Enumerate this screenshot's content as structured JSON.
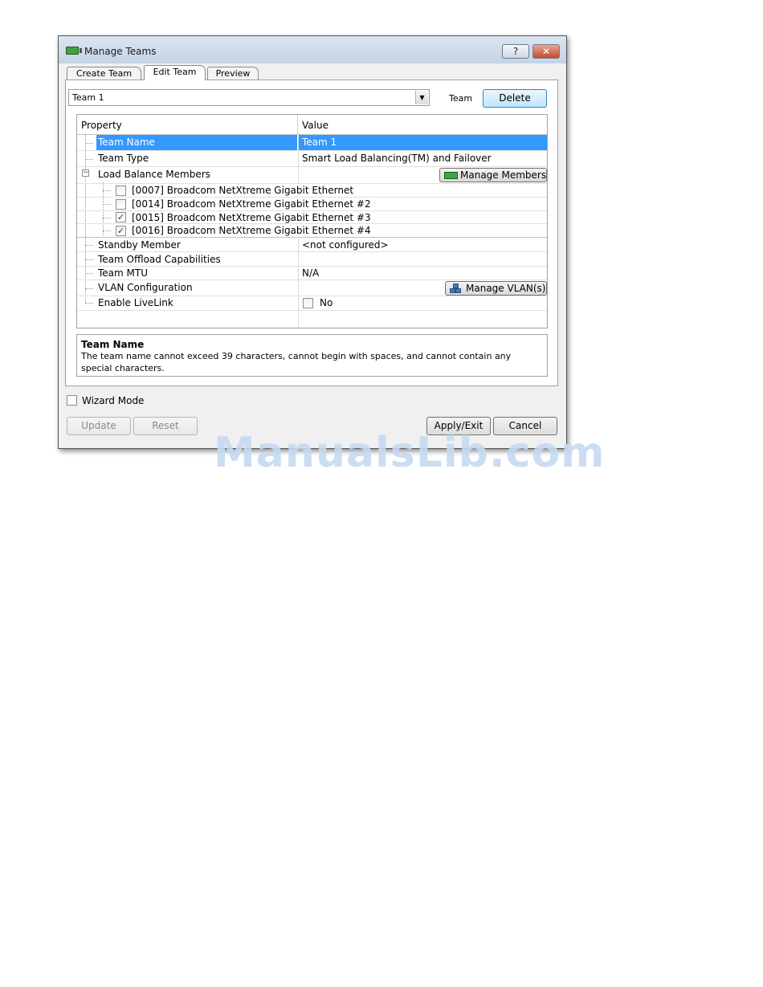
{
  "window": {
    "title": "Manage Teams",
    "help_label": "?",
    "close_label": "✕"
  },
  "tabs": [
    {
      "label": "Create Team"
    },
    {
      "label": "Edit Team",
      "active": true
    },
    {
      "label": "Preview"
    }
  ],
  "team_select": {
    "value": "Team 1",
    "label": "Team",
    "delete_label": "Delete"
  },
  "grid": {
    "headers": [
      "Property",
      "Value"
    ],
    "rows": {
      "team_name": {
        "property": "Team Name",
        "value": "Team 1",
        "selected": true
      },
      "team_type": {
        "property": "Team Type",
        "value": "Smart Load Balancing(TM) and Failover"
      },
      "load_balance": {
        "property": "Load Balance Members",
        "button": "Manage Members",
        "expander": "−"
      },
      "members": [
        {
          "label": "[0007] Broadcom NetXtreme Gigabit Ethernet",
          "checked": false
        },
        {
          "label": "[0014] Broadcom NetXtreme Gigabit Ethernet #2",
          "checked": false
        },
        {
          "label": "[0015] Broadcom NetXtreme Gigabit Ethernet #3",
          "checked": true
        },
        {
          "label": "[0016] Broadcom NetXtreme Gigabit Ethernet #4",
          "checked": true
        }
      ],
      "standby": {
        "property": "Standby Member",
        "value": "<not configured>"
      },
      "offload": {
        "property": "Team Offload Capabilities",
        "value": ""
      },
      "mtu": {
        "property": "Team MTU",
        "value": "N/A"
      },
      "vlan": {
        "property": "VLAN Configuration",
        "button": "Manage VLAN(s)"
      },
      "livelink": {
        "property": "Enable LiveLink",
        "value": "No",
        "checked": false
      }
    }
  },
  "description": {
    "title": "Team Name",
    "body": "The team name cannot exceed 39 characters, cannot begin with spaces, and cannot contain any special characters."
  },
  "wizard_mode": {
    "label": "Wizard Mode",
    "checked": false
  },
  "buttons": {
    "update": "Update",
    "reset": "Reset",
    "apply_exit": "Apply/Exit",
    "cancel": "Cancel"
  },
  "watermark": "ManualsLib.com",
  "check_mark": "✓",
  "combo_arrow": "▼",
  "colors": {
    "selection": "#3399ff",
    "window_bg": "#f0f0f0",
    "close_button": "#c44a2e"
  }
}
